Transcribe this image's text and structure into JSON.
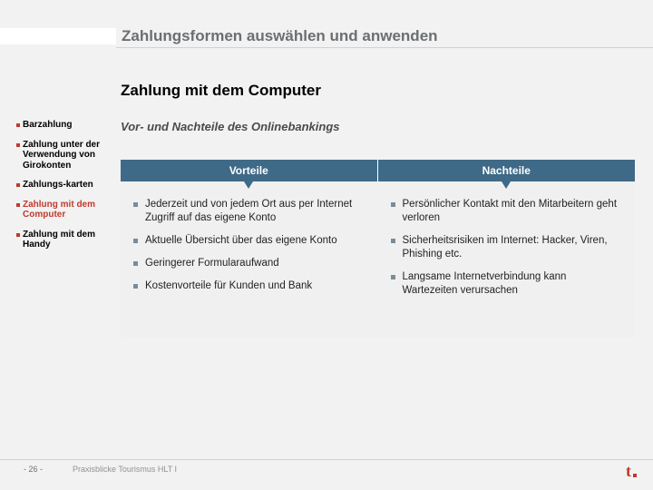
{
  "title": "Zahlungsformen auswählen und anwenden",
  "subtitle": "Zahlung mit dem Computer",
  "content_heading": "Vor- und Nachteile des Onlinebankings",
  "sidebar": {
    "items": [
      {
        "label": "Barzahlung"
      },
      {
        "label": "Zahlung unter der Verwendung von Girokonten"
      },
      {
        "label": "Zahlungs-karten"
      },
      {
        "label": "Zahlung mit dem Computer"
      },
      {
        "label": "Zahlung mit dem Handy"
      }
    ]
  },
  "columns": {
    "advantages": {
      "header": "Vorteile",
      "items": [
        "Jederzeit und von jedem Ort aus per Internet Zugriff auf das eigene Konto",
        "Aktuelle Übersicht über das eigene Konto",
        "Geringerer Formularaufwand",
        "Kostenvorteile für Kunden und Bank"
      ]
    },
    "disadvantages": {
      "header": "Nachteile",
      "items": [
        "Persönlicher Kontakt mit den Mitarbeitern geht verloren",
        "Sicherheitsrisiken im Internet: Hacker, Viren, Phishing etc.",
        "Langsame Internetverbindung kann Wartezeiten verursachen"
      ]
    }
  },
  "footer": {
    "page": "- 26 -",
    "text": "Praxisblicke Tourismus HLT I"
  },
  "logo": {
    "letter": "t"
  }
}
